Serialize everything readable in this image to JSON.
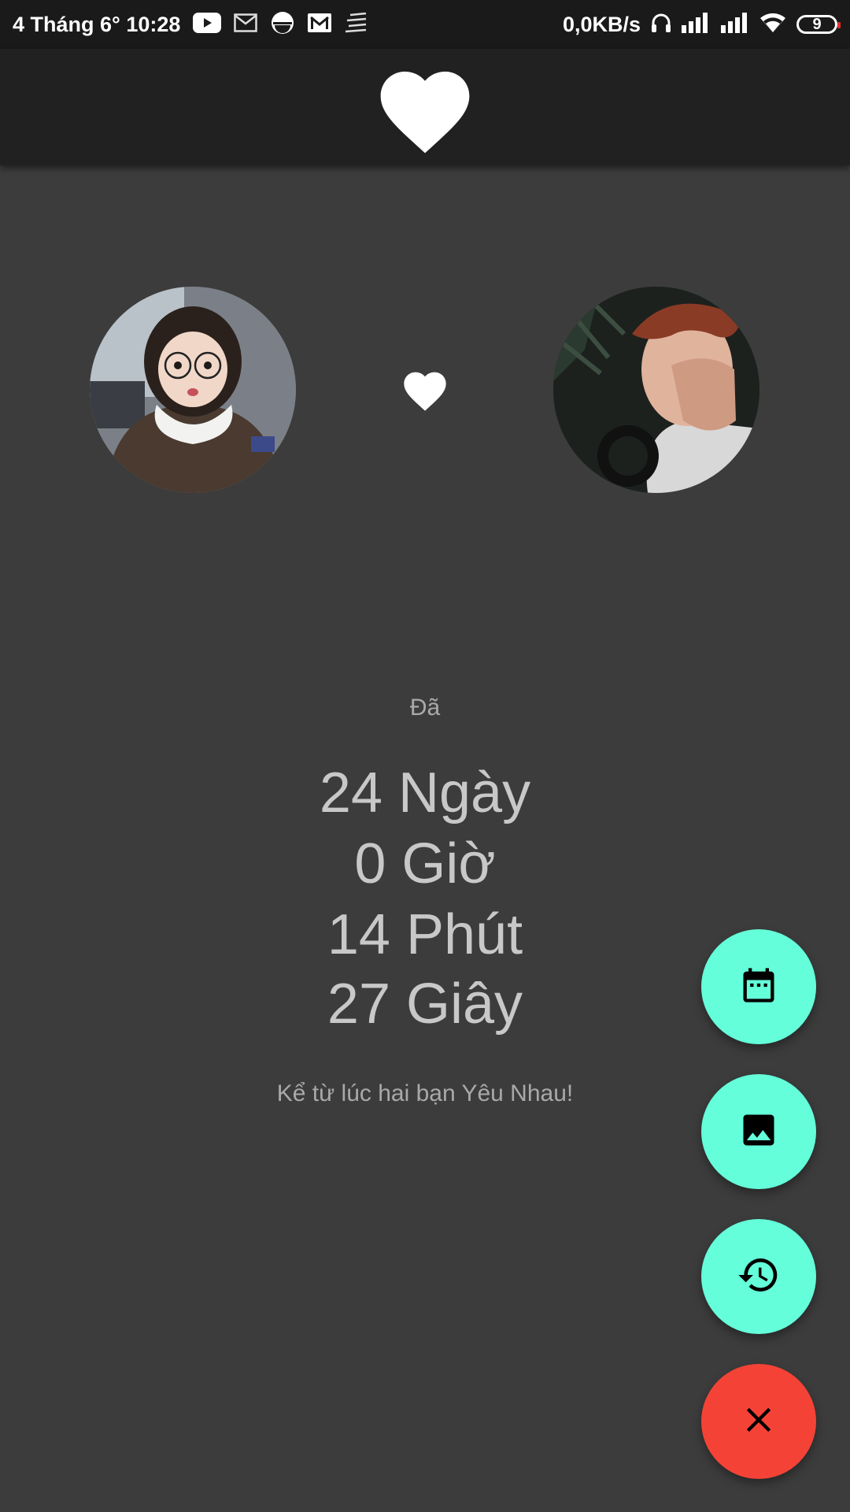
{
  "status_bar": {
    "left_text": "4 Tháng 6°  10:28",
    "speed": "0,0KB/s",
    "battery": "9",
    "icons": [
      "youtube-icon",
      "mail-icon",
      "circle-icon",
      "gmail-icon",
      "menu-lines-icon",
      "headphones-icon",
      "signal-icon",
      "signal-icon",
      "wifi-icon",
      "battery-icon"
    ]
  },
  "app_bar": {
    "icon": "heart-icon"
  },
  "couple": {
    "left_avatar": "avatar-girl",
    "right_avatar": "avatar-boy",
    "center_icon": "heart-icon"
  },
  "counter": {
    "prefix": "Đã",
    "days": "24 Ngày",
    "hours": "0 Giờ",
    "minutes": "14 Phút",
    "seconds": "27 Giây",
    "caption": "Kể từ lúc hai bạn Yêu Nhau!"
  },
  "fabs": [
    {
      "icon": "calendar-icon",
      "color": "#64ffda"
    },
    {
      "icon": "image-icon",
      "color": "#64ffda"
    },
    {
      "icon": "history-icon",
      "color": "#64ffda"
    },
    {
      "icon": "close-icon",
      "color": "#f44336"
    }
  ],
  "colors": {
    "background": "#3c3c3c",
    "app_bar": "#212121",
    "status_bar": "#1a1a1a",
    "accent": "#64ffda",
    "danger": "#f44336"
  }
}
